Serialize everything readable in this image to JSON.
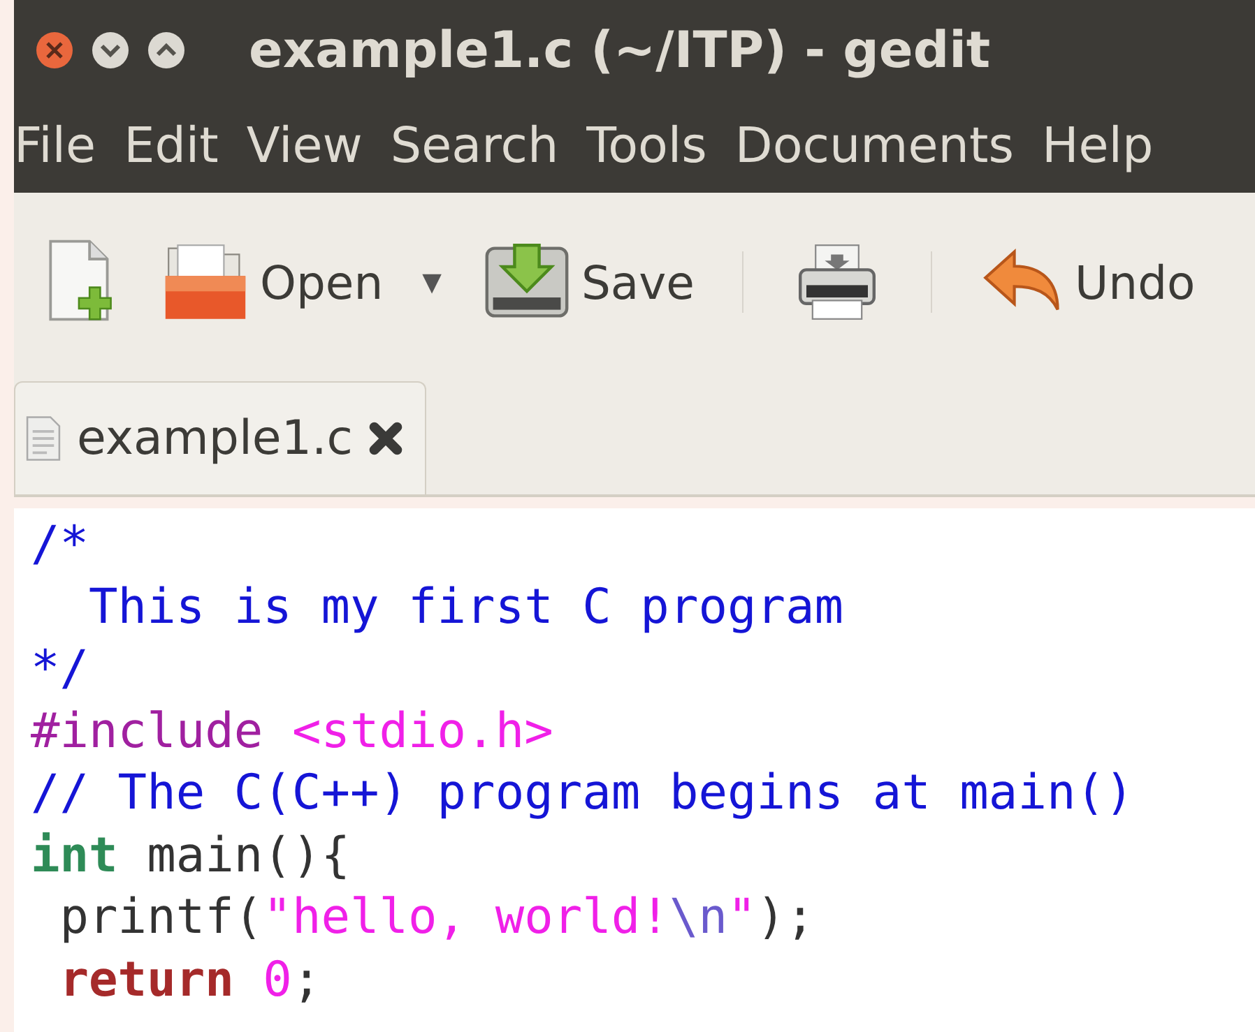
{
  "window": {
    "title": "example1.c (~/ITP) - gedit"
  },
  "menu": [
    "File",
    "Edit",
    "View",
    "Search",
    "Tools",
    "Documents",
    "Help"
  ],
  "toolbar": [
    {
      "kind": "new"
    },
    {
      "kind": "open",
      "label": "Open"
    },
    {
      "kind": "dropdown",
      "label": "▼"
    },
    {
      "kind": "save",
      "label": "Save"
    },
    {
      "kind": "separator"
    },
    {
      "kind": "print"
    },
    {
      "kind": "separator"
    },
    {
      "kind": "undo",
      "label": "Undo"
    }
  ],
  "tabs": [
    {
      "label": "example1.c",
      "selected": true
    }
  ],
  "code": [
    [
      {
        "kind": "comment",
        "text": "/*"
      }
    ],
    [
      {
        "kind": "comment",
        "text": "  This is my first C program"
      }
    ],
    [
      {
        "kind": "comment",
        "text": "*/"
      }
    ],
    [
      {
        "kind": "preproc",
        "text": "#include "
      },
      {
        "kind": "string",
        "text": "<stdio.h>"
      }
    ],
    [
      {
        "kind": "comment",
        "text": "// The C(C++) program begins at main()"
      }
    ],
    [
      {
        "kind": "type",
        "text": "int"
      },
      {
        "kind": "plain",
        "text": " main(){"
      }
    ],
    [
      {
        "kind": "plain",
        "text": " printf("
      },
      {
        "kind": "string",
        "text": "\"hello, world!"
      },
      {
        "kind": "escape",
        "text": "\\n"
      },
      {
        "kind": "string",
        "text": "\""
      },
      {
        "kind": "plain",
        "text": ");"
      }
    ],
    [
      {
        "kind": "keyword",
        "text": " return"
      },
      {
        "kind": "number",
        "text": " 0"
      },
      {
        "kind": "plain",
        "text": ";"
      }
    ]
  ]
}
